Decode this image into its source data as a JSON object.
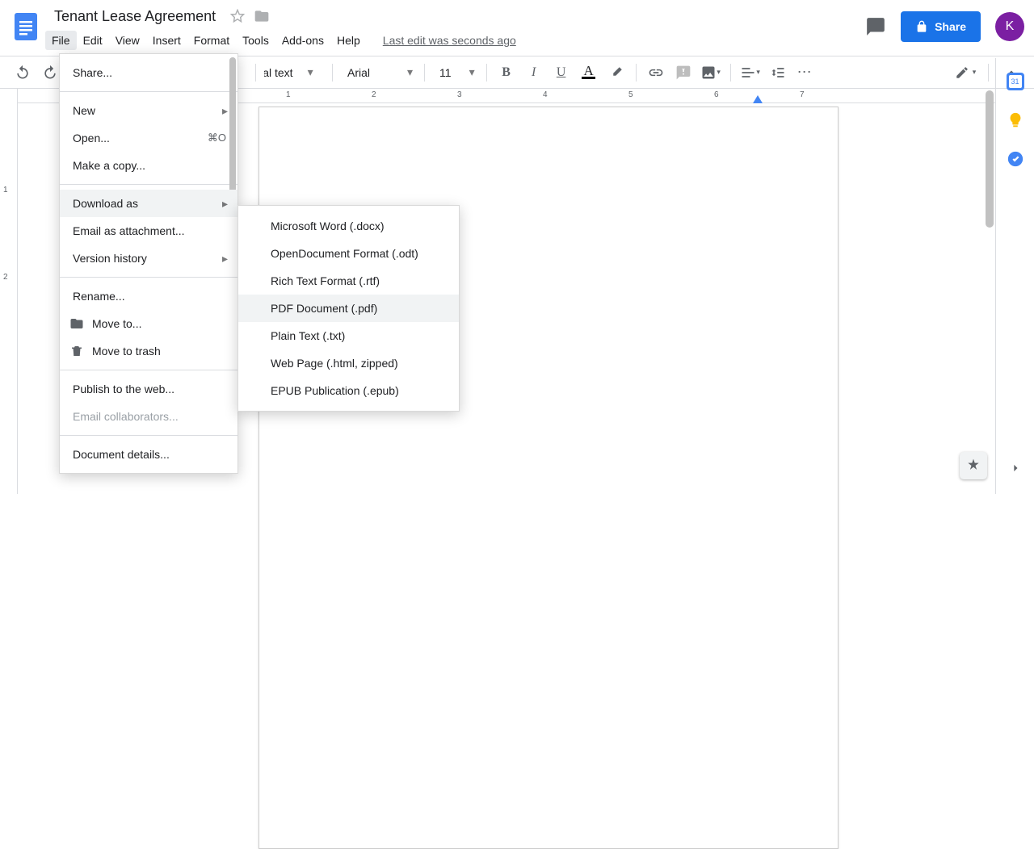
{
  "doc": {
    "title": "Tenant Lease Agreement",
    "last_edit": "Last edit was seconds ago"
  },
  "menubar": {
    "file": "File",
    "edit": "Edit",
    "view": "View",
    "insert": "Insert",
    "format": "Format",
    "tools": "Tools",
    "addons": "Add-ons",
    "help": "Help"
  },
  "header": {
    "share_label": "Share",
    "avatar_initial": "K"
  },
  "toolbar": {
    "style_label": "Normal text",
    "font_label": "Arial",
    "font_size": "11"
  },
  "file_menu": {
    "share": "Share...",
    "new": "New",
    "open": "Open...",
    "open_shortcut": "⌘O",
    "make_copy": "Make a copy...",
    "download_as": "Download as",
    "email_attachment": "Email as attachment...",
    "version_history": "Version history",
    "rename": "Rename...",
    "move_to": "Move to...",
    "move_trash": "Move to trash",
    "publish": "Publish to the web...",
    "email_collab": "Email collaborators...",
    "doc_details": "Document details..."
  },
  "download_menu": {
    "docx": "Microsoft Word (.docx)",
    "odt": "OpenDocument Format (.odt)",
    "rtf": "Rich Text Format (.rtf)",
    "pdf": "PDF Document (.pdf)",
    "txt": "Plain Text (.txt)",
    "html": "Web Page (.html, zipped)",
    "epub": "EPUB Publication (.epub)"
  },
  "ruler": {
    "h": [
      "1",
      "2",
      "3",
      "4",
      "5",
      "6",
      "7"
    ],
    "v": [
      "1",
      "2"
    ]
  }
}
